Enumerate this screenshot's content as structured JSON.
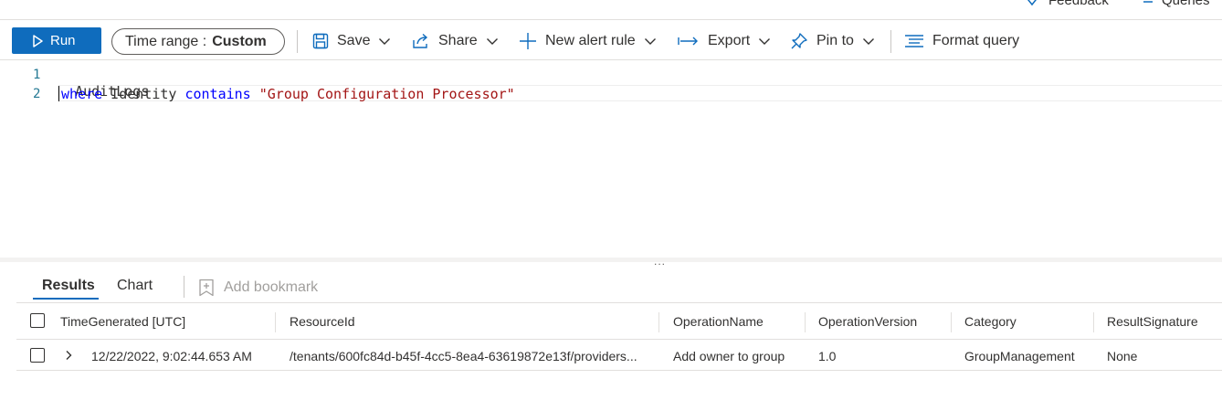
{
  "header": {
    "feedback_label": "Feedback",
    "queries_label": "Queries"
  },
  "toolbar": {
    "run_label": "Run",
    "time_range_label": "Time range :",
    "time_range_value": "Custom",
    "save_label": "Save",
    "share_label": "Share",
    "new_alert_rule_label": "New alert rule",
    "export_label": "Export",
    "pin_to_label": "Pin to",
    "format_query_label": "Format query"
  },
  "editor": {
    "line_numbers": [
      "1",
      "2"
    ],
    "line1": "AuditLogs",
    "line2_pipe": "|",
    "line2_where": "where",
    "line2_identity": " Identity ",
    "line2_contains": "contains",
    "line2_space": " ",
    "line2_string": "\"Group Configuration Processor\""
  },
  "splitter": {
    "handle": "..."
  },
  "results": {
    "tabs": [
      "Results",
      "Chart"
    ],
    "active_tab": "Results",
    "add_bookmark_label": "Add bookmark",
    "columns": [
      "TimeGenerated [UTC]",
      "ResourceId",
      "OperationName",
      "OperationVersion",
      "Category",
      "ResultSignature"
    ],
    "rows": [
      {
        "TimeGenerated": "12/22/2022, 9:02:44.653 AM",
        "ResourceId": "/tenants/600fc84d-b45f-4cc5-8ea4-63619872e13f/providers...",
        "OperationName": "Add owner to group",
        "OperationVersion": "1.0",
        "Category": "GroupManagement",
        "ResultSignature": "None"
      }
    ]
  },
  "colors": {
    "accent": "#0f6cbd",
    "keyword": "#0000ff",
    "string": "#a31515",
    "line_number": "#237893"
  }
}
